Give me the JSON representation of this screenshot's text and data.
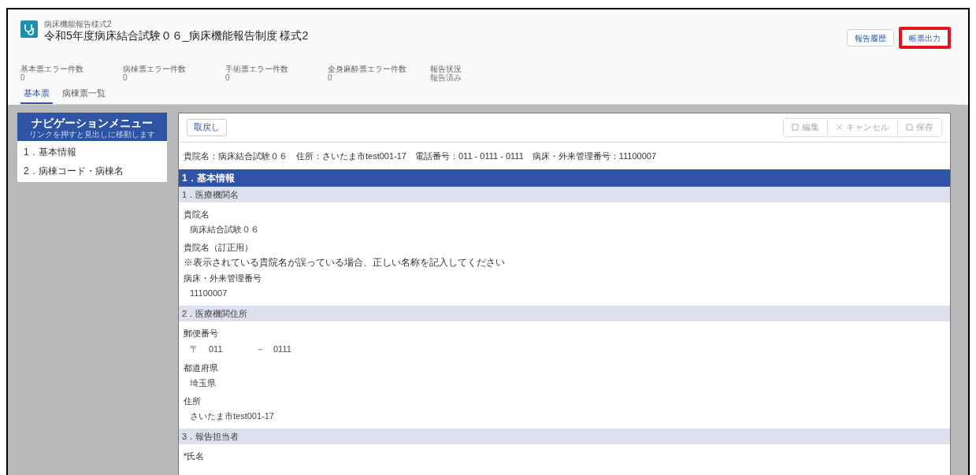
{
  "header": {
    "object_type": "病床機能報告様式2",
    "title": "令和5年度病床結合試験０６_病床機能報告制度 様式2",
    "buttons": [
      {
        "label": "報告履歴",
        "highlighted": false
      },
      {
        "label": "帳票出力",
        "highlighted": true
      }
    ]
  },
  "stats": [
    {
      "label": "基本票エラー件数",
      "value": "0"
    },
    {
      "label": "病棟票エラー件数",
      "value": "0"
    },
    {
      "label": "手術票エラー件数",
      "value": "0"
    },
    {
      "label": "全身麻酔票エラー件数",
      "value": "0"
    },
    {
      "label": "報告状況",
      "value": "報告済み"
    }
  ],
  "tabs": [
    {
      "label": "基本票",
      "selected": true
    },
    {
      "label": "病棟票一覧",
      "selected": false
    }
  ],
  "nav": {
    "title": "ナビゲーションメニュー",
    "subtitle": "リンクを押すと見出しに移動します",
    "items": [
      "1．基本情報",
      "2．病棟コード・病棟名"
    ]
  },
  "toolbar": {
    "back": "取戻し",
    "actions": [
      {
        "label": "編集"
      },
      {
        "label": "キャンセル"
      },
      {
        "label": "保存"
      }
    ]
  },
  "info_line": "貴院名：病床結合試験０６　住所：さいたま市test001-17　電話番号：011 - 0111 - 0111　病床・外来管理番号：11100007",
  "section": "1．基本情報",
  "groups": [
    {
      "title": "1．医療機関名",
      "fields": [
        {
          "kind": "label",
          "text": "貴院名"
        },
        {
          "kind": "value",
          "text": "病床結合試験０６"
        },
        {
          "kind": "label",
          "text": "貴院名（訂正用）"
        },
        {
          "kind": "note",
          "text": "※表示されている貴院名が誤っている場合、正しい名称を記入してください"
        },
        {
          "kind": "label",
          "text": "病床・外来管理番号"
        },
        {
          "kind": "value",
          "text": "11100007"
        }
      ]
    },
    {
      "title": "2．医療機関住所",
      "fields": [
        {
          "kind": "label",
          "text": "郵便番号"
        },
        {
          "kind": "postal",
          "mark": "〒",
          "first": "011",
          "dash": "－",
          "second": "0111"
        },
        {
          "kind": "label",
          "text": "都道府県"
        },
        {
          "kind": "value",
          "text": "埼玉県"
        },
        {
          "kind": "label",
          "text": "住所"
        },
        {
          "kind": "value",
          "text": "さいたま市test001-17"
        }
      ]
    },
    {
      "title": "3．報告担当者",
      "fields": [
        {
          "kind": "label",
          "text": "*氏名"
        }
      ]
    }
  ]
}
